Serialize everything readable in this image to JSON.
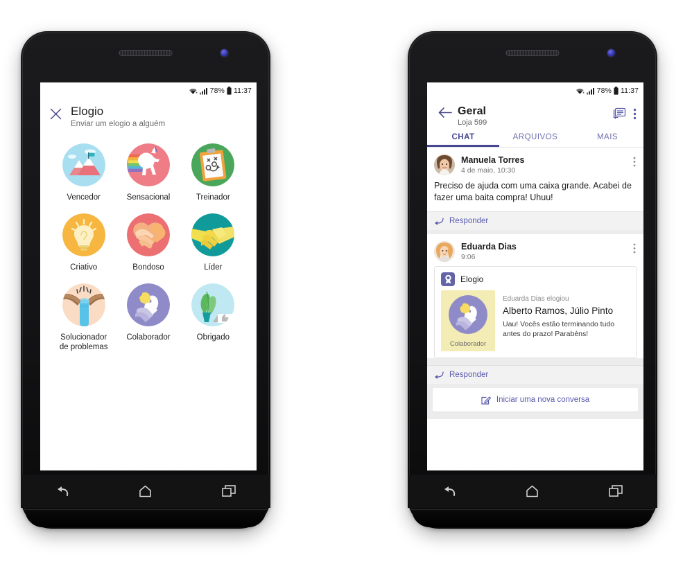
{
  "status_bar": {
    "battery": "78%",
    "time": "11:37",
    "icons": [
      "wifi-icon",
      "signal-icon",
      "battery-icon"
    ]
  },
  "left_phone": {
    "name": "elogio-picker-phone",
    "header": {
      "close_icon": "close-icon",
      "title": "Elogio",
      "subtitle": "Enviar um elogio a alguém"
    },
    "badges": [
      {
        "label": "Vencedor",
        "art": "mountain-flag-badge",
        "bg": "#a8dff0"
      },
      {
        "label": "Sensacional",
        "art": "unicorn-rainbow-badge",
        "bg": "#ef7d87"
      },
      {
        "label": "Treinador",
        "art": "clipboard-plays-badge",
        "bg": "#4aa65a"
      },
      {
        "label": "Criativo",
        "art": "lightbulb-badge",
        "bg": "#f6b63f"
      },
      {
        "label": "Bondoso",
        "art": "heart-hands-badge",
        "bg": "#ec6f72"
      },
      {
        "label": "Líder",
        "art": "handshake-badge",
        "bg": "#119a9a"
      },
      {
        "label": "Solucionador\nde problemas",
        "art": "breaking-chains-badge",
        "bg": "#fadcc4"
      },
      {
        "label": "Colaborador",
        "art": "collaborator-badge",
        "bg": "#8f8bc8"
      },
      {
        "label": "Obrigado",
        "art": "plant-thanks-badge",
        "bg": "#bfe8f2"
      }
    ],
    "nav_icons": [
      "back-icon",
      "home-icon",
      "recents-icon"
    ]
  },
  "right_phone": {
    "name": "channel-chat-phone",
    "header": {
      "back_icon": "back-arrow-icon",
      "title": "Geral",
      "subtitle": "Loja 599",
      "announcement_icon": "announcement-icon",
      "overflow_icon": "overflow-menu-icon"
    },
    "tabs": [
      {
        "label": "CHAT",
        "active": true
      },
      {
        "label": "ARQUIVOS",
        "active": false
      },
      {
        "label": "MAIS",
        "active": false
      }
    ],
    "posts": [
      {
        "author": "Manuela Torres",
        "timestamp": "4 de maio, 10:30",
        "avatar": "avatar-manuela",
        "text": "Preciso de ajuda com uma caixa grande. Acabei de fazer uma baita compra! Uhuu!",
        "reply_label": "Responder",
        "reply_icon": "reply-arrow-icon"
      },
      {
        "author": "Eduarda Dias",
        "timestamp": "9:06",
        "avatar": "avatar-eduarda",
        "reply_label": "Responder",
        "reply_icon": "reply-arrow-icon",
        "praise_card": {
          "app_name": "Elogio",
          "app_icon": "award-ribbon-icon",
          "badge_art": "collaborator-badge",
          "badge_label": "Colaborador",
          "from_line": "Eduarda Dias elogiou",
          "recipients": "Alberto Ramos, Júlio Pinto",
          "message": "Uau! Vocês estão terminando tudo antes do prazo! Parabéns!"
        }
      }
    ],
    "new_conversation": {
      "label": "Iniciar uma nova conversa",
      "icon": "compose-icon"
    },
    "nav_icons": [
      "back-icon",
      "home-icon",
      "recents-icon"
    ]
  },
  "colors": {
    "accent_purple": "#464693",
    "link_purple": "#5b5bad",
    "praise_yellow": "#f3ecb4",
    "feed_gray": "#ececed"
  }
}
